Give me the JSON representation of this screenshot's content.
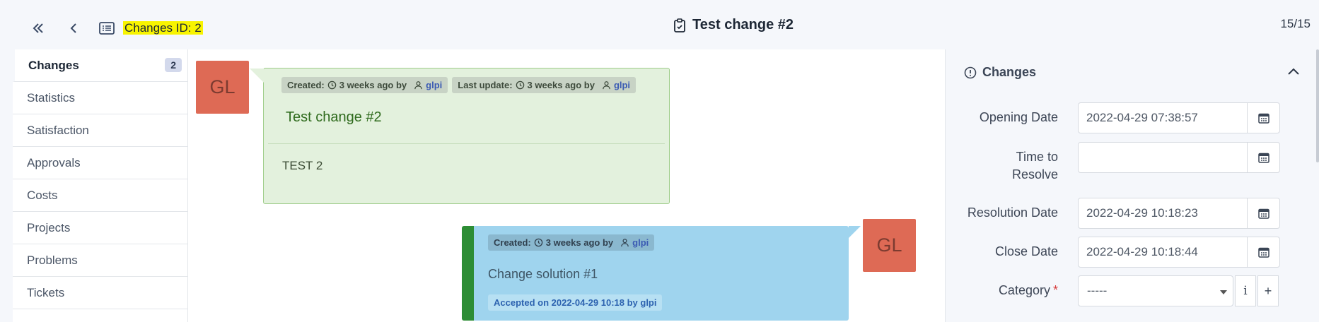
{
  "header": {
    "breadcrumb": "Changes ID: 2",
    "title": "Test change #2",
    "counter": "15/15"
  },
  "sidebar": {
    "items": [
      {
        "label": "Changes",
        "badge": "2"
      },
      {
        "label": "Statistics"
      },
      {
        "label": "Satisfaction"
      },
      {
        "label": "Approvals"
      },
      {
        "label": "Costs"
      },
      {
        "label": "Projects"
      },
      {
        "label": "Problems"
      },
      {
        "label": "Tickets"
      }
    ]
  },
  "timeline": {
    "item1": {
      "avatar": "GL",
      "created_label": "Created:",
      "created_when": "3 weeks ago by",
      "created_by": "glpi",
      "updated_label": "Last update:",
      "updated_when": "3 weeks ago by",
      "updated_by": "glpi",
      "title": "Test change #2",
      "content": "TEST 2"
    },
    "item2": {
      "avatar": "GL",
      "created_label": "Created:",
      "created_when": "3 weeks ago by",
      "created_by": "glpi",
      "title": "Change solution #1",
      "status": "Accepted on 2022-04-29 10:18 by glpi"
    }
  },
  "panel": {
    "title": "Changes",
    "fields": {
      "opening_label": "Opening Date",
      "opening_value": "2022-04-29 07:38:57",
      "ttr_label": "Time to Resolve",
      "ttr_value": "",
      "resolution_label": "Resolution Date",
      "resolution_value": "2022-04-29 10:18:23",
      "close_label": "Close Date",
      "close_value": "2022-04-29 10:18:44",
      "category_label": "Category",
      "category_value": "-----"
    }
  },
  "colors": {
    "highlight": "#f8f400",
    "avatar": "#de6a55",
    "followup_bg": "#e3f1dd",
    "solution_bg": "#9fd4ee",
    "solution_accent": "#2d8d35"
  }
}
